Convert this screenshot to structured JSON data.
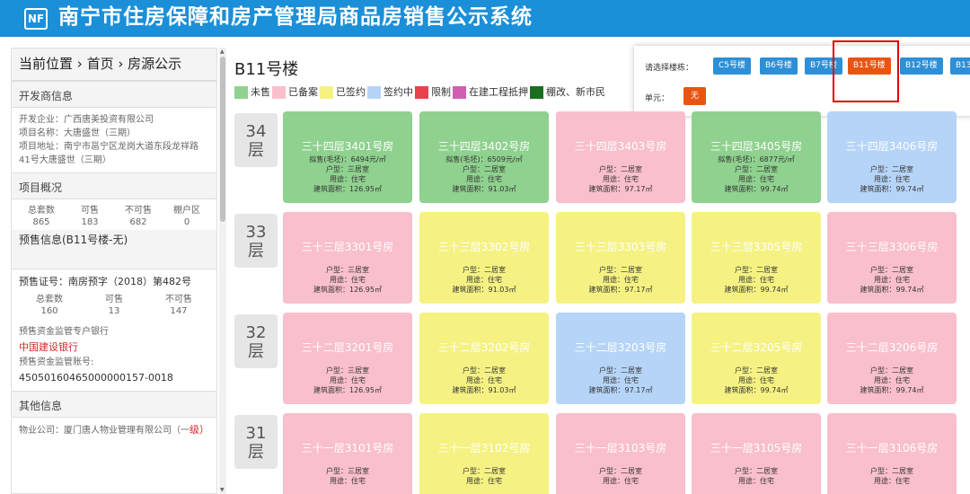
{
  "header": {
    "logo_text": "NF",
    "title": "南宁市住房保障和房产管理局商品房销售公示系统"
  },
  "sidebar": {
    "breadcrumb": {
      "p1": "当前位置",
      "sep1": "›",
      "p2": "首页",
      "sep2": "›",
      "p3": "房源公示"
    },
    "developer_title": "开发商信息",
    "developer_lines": [
      "开发企业：广西唐美投资有限公司",
      "项目名称：大唐盛世（三期）",
      "项目地址：南宁市邕宁区龙岗大道东段龙祥路",
      "41号大唐盛世（三期）"
    ],
    "overview_title": "项目概况",
    "overview_stats": [
      {
        "label": "总套数",
        "value": "865"
      },
      {
        "label": "可售",
        "value": "183"
      },
      {
        "label": "不可售",
        "value": "682"
      },
      {
        "label": "棚户区",
        "value": "0"
      }
    ],
    "presale_title": "预售信息(B11号楼-无)",
    "presale_cert": "预售证号：南房预字（2018）第482号",
    "presale_stats": [
      {
        "label": "总套数",
        "value": "160"
      },
      {
        "label": "可售",
        "value": "13"
      },
      {
        "label": "不可售",
        "value": "147"
      }
    ],
    "bank_label": "预售资金监管专户银行",
    "bank_name": "中国建设银行",
    "account_label": "预售资金监管账号:",
    "account_no": "45050160465000000157-0018",
    "other_title": "其他信息",
    "property_co": "物业公司：厦门唐人物业管理有限公司（一",
    "property_co_level": "级）"
  },
  "building": {
    "title": "B11号楼"
  },
  "legend": [
    {
      "label": "未售",
      "color": "#8fd18f"
    },
    {
      "label": "已备案",
      "color": "#f9bfcc"
    },
    {
      "label": "已签约",
      "color": "#f5f283"
    },
    {
      "label": "签约中",
      "color": "#b6d4f7"
    },
    {
      "label": "限制",
      "color": "#e8424d"
    },
    {
      "label": "在建工程抵押",
      "color": "#cf5fb1"
    },
    {
      "label": "棚改、新市民",
      "color": "#1b6e1f"
    }
  ],
  "selector": {
    "label": "请选择楼栋：",
    "unit_label": "单元：",
    "unit_value": "无",
    "buildings": [
      "C5号楼",
      "B6号楼",
      "B7号楼",
      "B11号楼",
      "B12号楼",
      "B13"
    ],
    "selected": "B11号楼"
  },
  "floors": [
    {
      "label": "34\n层",
      "units": [
        {
          "name": "三十四层3401号房",
          "price": "拟售(毛坯)：6494元/㎡",
          "type": "户型：三居室",
          "use": "用途：住宅",
          "area": "建筑面积：126.95㎡",
          "status": "未售",
          "color": "#8fd18f"
        },
        {
          "name": "三十四层3402号房",
          "price": "拟售(毛坯)：6509元/㎡",
          "type": "户型：二居室",
          "use": "用途：住宅",
          "area": "建筑面积：91.03㎡",
          "status": "未售",
          "color": "#8fd18f"
        },
        {
          "name": "三十四层3403号房",
          "price": "",
          "type": "户型：二居室",
          "use": "用途：住宅",
          "area": "建筑面积：97.17㎡",
          "status": "已备案",
          "color": "#f9bfcc"
        },
        {
          "name": "三十四层3405号房",
          "price": "拟售(毛坯)：6877元/㎡",
          "type": "户型：二居室",
          "use": "用途：住宅",
          "area": "建筑面积：99.74㎡",
          "status": "未售",
          "color": "#8fd18f"
        },
        {
          "name": "三十四层3406号房",
          "price": "",
          "type": "户型：二居室",
          "use": "用途：住宅",
          "area": "建筑面积：99.74㎡",
          "status": "签约中",
          "color": "#b6d4f7"
        }
      ]
    },
    {
      "label": "33\n层",
      "units": [
        {
          "name": "三十三层3301号房",
          "price": "",
          "type": "户型：三居室",
          "use": "用途：住宅",
          "area": "建筑面积：126.95㎡",
          "status": "已备案",
          "color": "#f9bfcc"
        },
        {
          "name": "三十三层3302号房",
          "price": "",
          "type": "户型：二居室",
          "use": "用途：住宅",
          "area": "建筑面积：91.03㎡",
          "status": "已签约",
          "color": "#f5f283"
        },
        {
          "name": "三十三层3303号房",
          "price": "",
          "type": "户型：二居室",
          "use": "用途：住宅",
          "area": "建筑面积：97.17㎡",
          "status": "已签约",
          "color": "#f5f283"
        },
        {
          "name": "三十三层3305号房",
          "price": "",
          "type": "户型：二居室",
          "use": "用途：住宅",
          "area": "建筑面积：99.74㎡",
          "status": "已签约",
          "color": "#f5f283"
        },
        {
          "name": "三十三层3306号房",
          "price": "",
          "type": "户型：二居室",
          "use": "用途：住宅",
          "area": "建筑面积：99.74㎡",
          "status": "已备案",
          "color": "#f9bfcc"
        }
      ]
    },
    {
      "label": "32\n层",
      "units": [
        {
          "name": "三十二层3201号房",
          "price": "",
          "type": "户型：三居室",
          "use": "用途：住宅",
          "area": "建筑面积：126.95㎡",
          "status": "已备案",
          "color": "#f9bfcc"
        },
        {
          "name": "三十二层3202号房",
          "price": "",
          "type": "户型：二居室",
          "use": "用途：住宅",
          "area": "建筑面积：91.03㎡",
          "status": "已签约",
          "color": "#f5f283"
        },
        {
          "name": "三十二层3203号房",
          "price": "",
          "type": "户型：二居室",
          "use": "用途：住宅",
          "area": "建筑面积：97.17㎡",
          "status": "签约中",
          "color": "#b6d4f7"
        },
        {
          "name": "三十二层3205号房",
          "price": "",
          "type": "户型：二居室",
          "use": "用途：住宅",
          "area": "建筑面积：99.74㎡",
          "status": "已签约",
          "color": "#f5f283"
        },
        {
          "name": "三十二层3206号房",
          "price": "",
          "type": "户型：二居室",
          "use": "用途：住宅",
          "area": "建筑面积：99.74㎡",
          "status": "已备案",
          "color": "#f9bfcc"
        }
      ]
    },
    {
      "label": "31\n层",
      "units": [
        {
          "name": "三十一层3101号房",
          "price": "",
          "type": "户型：三居室",
          "use": "用途：住宅",
          "area": "",
          "status": "已备案",
          "color": "#f9bfcc"
        },
        {
          "name": "三十一层3102号房",
          "price": "",
          "type": "户型：二居室",
          "use": "用途：住宅",
          "area": "",
          "status": "已签约",
          "color": "#f5f283"
        },
        {
          "name": "三十一层3103号房",
          "price": "",
          "type": "户型：二居室",
          "use": "用途：住宅",
          "area": "",
          "status": "已备案",
          "color": "#f9bfcc"
        },
        {
          "name": "三十一层3105号房",
          "price": "",
          "type": "户型：二居室",
          "use": "用途：住宅",
          "area": "",
          "status": "已备案",
          "color": "#f9bfcc"
        },
        {
          "name": "三十一层3106号房",
          "price": "",
          "type": "户型：二居室",
          "use": "用途：住宅",
          "area": "",
          "status": "已备案",
          "color": "#f9bfcc"
        }
      ]
    }
  ]
}
